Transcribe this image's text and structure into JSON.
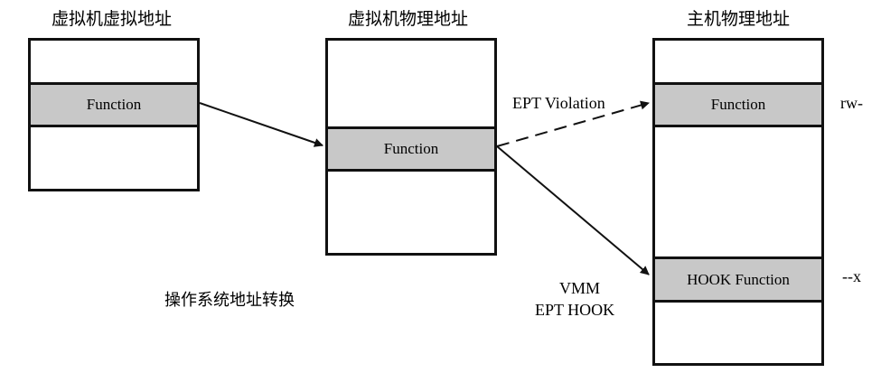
{
  "columns": {
    "guest_virtual": {
      "title": "虚拟机虚拟地址",
      "row_label": "Function"
    },
    "guest_physical": {
      "title": "虚拟机物理地址",
      "row_label": "Function"
    },
    "host_physical": {
      "title": "主机物理地址",
      "row_top_label": "Function",
      "row_bottom_label": "HOOK Function"
    }
  },
  "annotations": {
    "ept_violation": "EPT Violation",
    "vmm": "VMM",
    "ept_hook": "EPT HOOK",
    "perm_rw": "rw-",
    "perm_x": "--x",
    "os_translation": "操作系统地址转换"
  }
}
